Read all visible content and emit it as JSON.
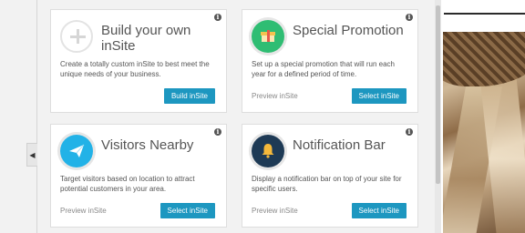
{
  "cards": [
    {
      "title": "Build your own inSite",
      "description": "Create a totally custom inSite to best meet the unique needs of your business.",
      "preview": "",
      "button": "Build inSite",
      "icon": "plus-icon"
    },
    {
      "title": "Special Promotion",
      "description": "Set up a special promotion that will run each year for a defined period of time.",
      "preview": "Preview inSite",
      "button": "Select inSite",
      "icon": "gift-icon"
    },
    {
      "title": "Visitors Nearby",
      "description": "Target visitors based on location to attract potential customers in your area.",
      "preview": "Preview inSite",
      "button": "Select inSite",
      "icon": "paper-plane-icon"
    },
    {
      "title": "Notification Bar",
      "description": "Display a notification bar on top of your site for specific users.",
      "preview": "Preview inSite",
      "button": "Select inSite",
      "icon": "bell-icon"
    }
  ],
  "info_glyph": "i",
  "collapse_glyph": "◀",
  "colors": {
    "button": "#1d97c0",
    "promo_icon": "#2fbd73",
    "visitors_icon": "#22b2e7",
    "notify_icon": "#1e3a55"
  }
}
